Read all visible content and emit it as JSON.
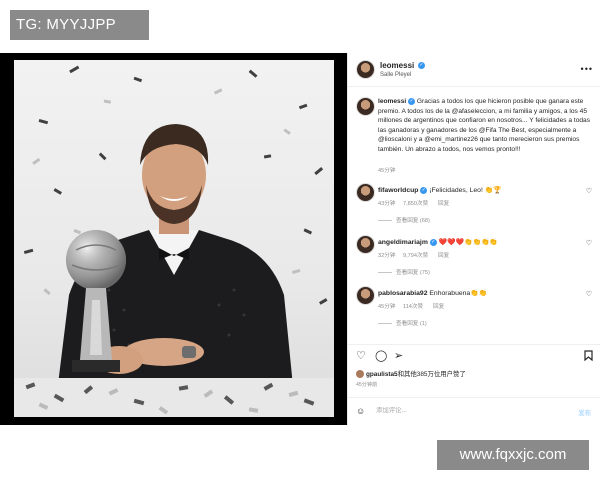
{
  "overlay": {
    "tag_label": "TG: MYYJJPP",
    "watermark": "www.fqxxjc.com"
  },
  "header": {
    "username": "leomessi",
    "subtitle": "Salle Pleyel",
    "more_icon": "more-icon"
  },
  "caption": {
    "username": "leomessi",
    "text": "Gracias a todos los que hicieron posible que ganara este premio. A todos los de la @afaseleccion, a mi familia y amigos, a los 45 millones de argentinos que confiaron en nosotros... Y felicidades a todas las ganadoras y ganadores de los @Fifa The Best, especialmente a @lioscaloni y a @emi_martinez26 que tanto merecieron sus premios también. Un abrazo a todos, nos vemos pronto!!!",
    "time": "45分钟"
  },
  "comments": [
    {
      "username": "fifaworldcup",
      "text": "¡Felicidades, Leo! 👏🏆",
      "time": "43分钟",
      "likes": "7,850次赞",
      "reply_label": "回复",
      "replies": "查看回复 (68)"
    },
    {
      "username": "angeldimariajm",
      "text": "❤️❤️❤️👏👏👏👏",
      "time": "32分钟",
      "likes": "9,794次赞",
      "reply_label": "回复",
      "replies": "查看回复 (75)"
    },
    {
      "username": "pablosarabia92",
      "text": "Enhorabuena👏👏",
      "time": "45分钟",
      "likes": "114次赞",
      "reply_label": "回复",
      "replies": "查看回复 (1)"
    }
  ],
  "likes": {
    "username": "gpaulista5",
    "text": "和其他385万位用户赞了"
  },
  "post_time": "45分钟前",
  "comment_input": {
    "placeholder": "添加评论...",
    "publish_label": "发布"
  },
  "icons": {
    "like": "heart-icon",
    "comment": "comment-icon",
    "share": "send-icon",
    "save": "bookmark-icon",
    "emoji": "emoji-icon"
  }
}
